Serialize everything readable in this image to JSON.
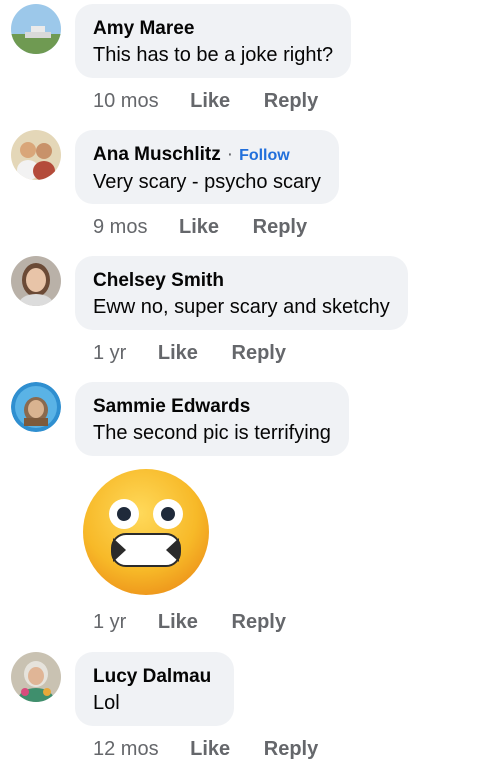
{
  "comments": [
    {
      "author": "Amy Maree",
      "text": "This has to be a joke right?",
      "time": "10 mos",
      "like": "Like",
      "reply": "Reply"
    },
    {
      "author": "Ana Muschlitz",
      "separator": "·",
      "follow": "Follow",
      "text": "Very scary - psycho scary",
      "time": "9 mos",
      "like": "Like",
      "reply": "Reply"
    },
    {
      "author": "Chelsey Smith",
      "text": "Eww no, super scary and sketchy",
      "time": "1 yr",
      "like": "Like",
      "reply": "Reply"
    },
    {
      "author": "Sammie Edwards",
      "text": "The second pic is terrifying",
      "sticker": "grimacing-face-emoji",
      "time": "1 yr",
      "like": "Like",
      "reply": "Reply"
    },
    {
      "author": "Lucy Dalmau",
      "text": "Lol",
      "time": "12 mos",
      "like": "Like",
      "reply": "Reply"
    }
  ],
  "colors": {
    "bubble": "#f0f2f5",
    "meta": "#65676b",
    "follow": "#216fdb",
    "emoji": "#f7b928"
  }
}
